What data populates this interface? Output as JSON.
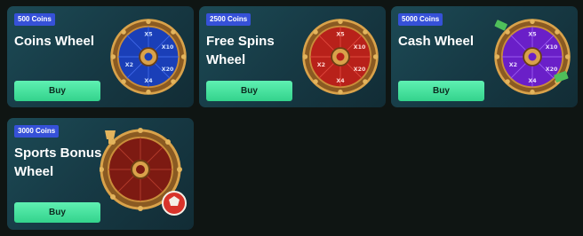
{
  "cards": [
    {
      "badge": "500 Coins",
      "title": "Coins Wheel",
      "buy_label": "Buy"
    },
    {
      "badge": "2500 Coins",
      "title": "Free Spins Wheel",
      "buy_label": "Buy"
    },
    {
      "badge": "5000 Coins",
      "title": "Cash Wheel",
      "buy_label": "Buy"
    },
    {
      "badge": "3000 Coins",
      "title": "Sports Bonus Wheel",
      "buy_label": "Buy"
    }
  ],
  "wheels": [
    {
      "icon": "coins-wheel-icon",
      "color": "#1a3fb8",
      "labels": [
        "X5",
        "X10",
        "X20",
        "X4",
        "X2"
      ]
    },
    {
      "icon": "free-spins-wheel-icon",
      "color": "#b8211a",
      "labels": [
        "X5",
        "X10",
        "X20",
        "X4",
        "X2"
      ]
    },
    {
      "icon": "cash-wheel-icon",
      "color": "#6a1fc8",
      "labels": [
        "X5",
        "X10",
        "X20",
        "X4",
        "X2"
      ]
    },
    {
      "icon": "sports-bonus-wheel-icon",
      "color": "#7d1a12",
      "labels": []
    }
  ],
  "colors": {
    "badge": "#3651d8",
    "buy_button": "#3fe09c",
    "card_bg": "#173b46",
    "page_bg": "#0f1513"
  }
}
